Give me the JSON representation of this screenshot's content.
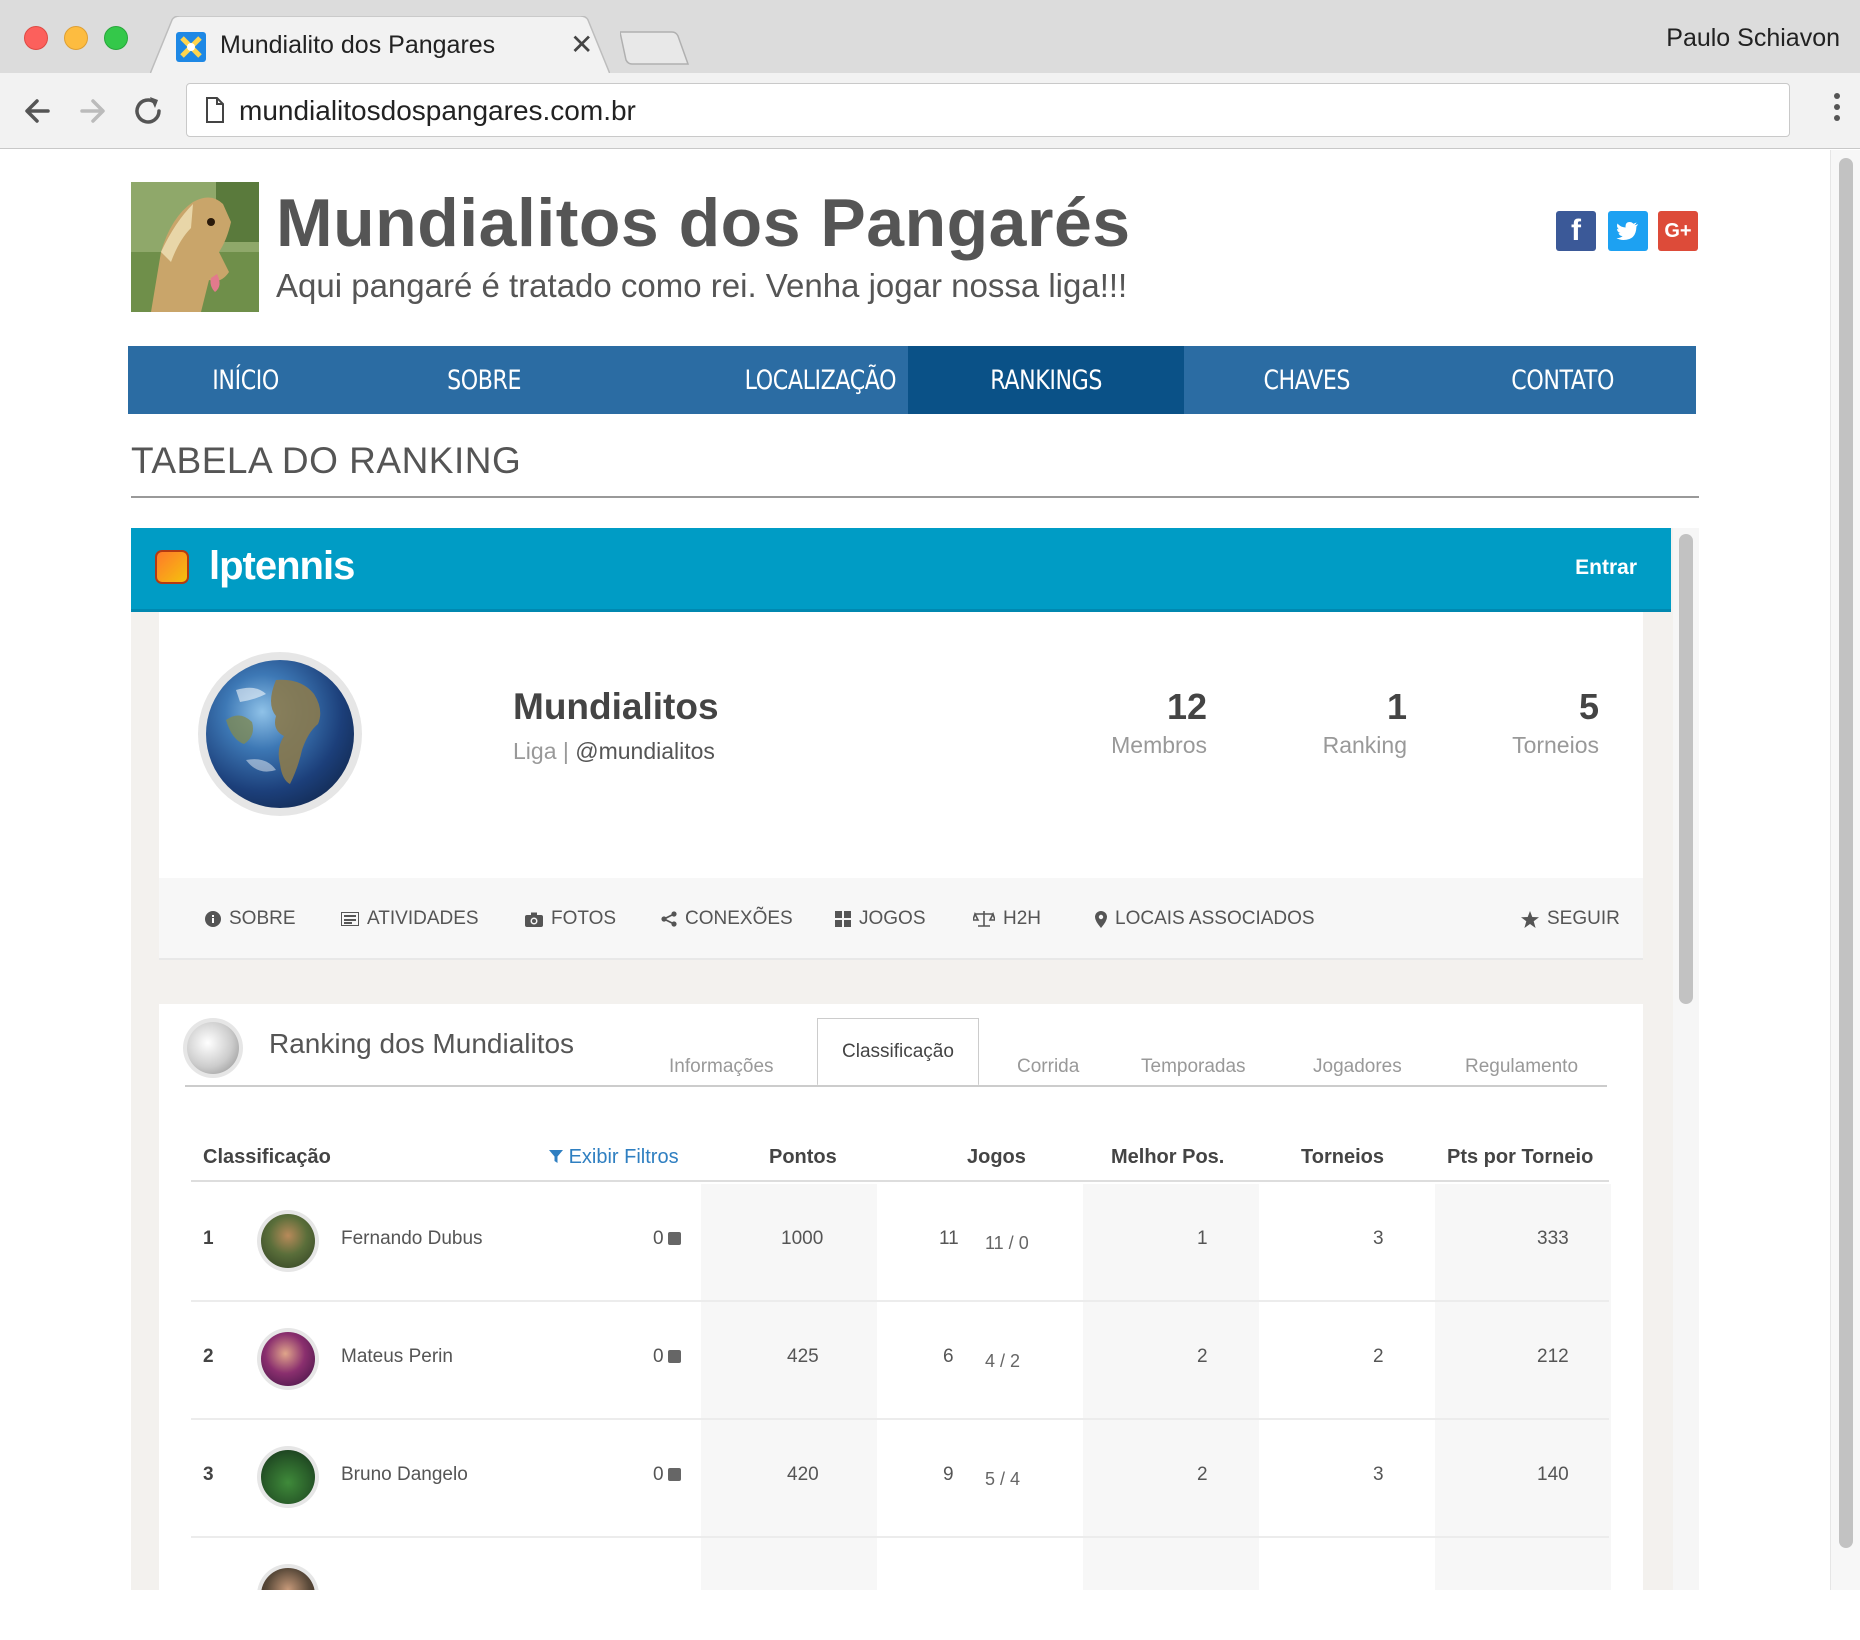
{
  "browser": {
    "tab_title": "Mundialito dos Pangares",
    "profile_name": "Paulo Schiavon",
    "url": "mundialitosdospangares.com.br"
  },
  "site": {
    "title": "Mundialitos dos Pangarés",
    "subtitle": "Aqui pangaré é tratado como rei. Venha jogar nossa liga!!!",
    "social": [
      {
        "label": "f",
        "color": "#3b5998"
      },
      {
        "label": "t",
        "color": "#1da1f2"
      },
      {
        "label": "G+",
        "color": "#dd4b39"
      }
    ]
  },
  "nav": {
    "items": [
      "INÍCIO",
      "SOBRE",
      "LOCALIZAÇÃO",
      "RANKINGS",
      "CHAVES",
      "CONTATO"
    ],
    "active": "RANKINGS"
  },
  "section_title": "TABELA DO RANKING",
  "lptennis": {
    "logo_text": "lptennis",
    "login_label": "Entrar",
    "league": {
      "name": "Mundialitos",
      "type": "Liga",
      "separator": "|",
      "handle": "@mundialitos"
    },
    "stats": [
      {
        "value": "12",
        "label": "Membros"
      },
      {
        "value": "1",
        "label": "Ranking"
      },
      {
        "value": "5",
        "label": "Torneios"
      }
    ],
    "tabs": [
      "SOBRE",
      "ATIVIDADES",
      "FOTOS",
      "CONEXÕES",
      "JOGOS",
      "H2H",
      "LOCAIS ASSOCIADOS"
    ],
    "follow_label": "SEGUIR",
    "ranking": {
      "title": "Ranking dos Mundialitos",
      "subtabs": [
        "Informações",
        "Classificação",
        "Corrida",
        "Temporadas",
        "Jogadores",
        "Regulamento"
      ],
      "active_subtab": "Classificação",
      "columns": {
        "classificacao": "Classificação",
        "filter": "Exibir Filtros",
        "pontos": "Pontos",
        "jogos": "Jogos",
        "melhor_pos": "Melhor Pos.",
        "torneios": "Torneios",
        "pts_por_torneio": "Pts por Torneio"
      },
      "rows": [
        {
          "pos": "1",
          "name": "Fernando Dubus",
          "delta": "0",
          "pontos": "1000",
          "jogos": "11",
          "vd": "11 / 0",
          "melhor": "1",
          "torneios": "3",
          "ppt": "333"
        },
        {
          "pos": "2",
          "name": "Mateus Perin",
          "delta": "0",
          "pontos": "425",
          "jogos": "6",
          "vd": "4 / 2",
          "melhor": "2",
          "torneios": "2",
          "ppt": "212"
        },
        {
          "pos": "3",
          "name": "Bruno Dangelo",
          "delta": "0",
          "pontos": "420",
          "jogos": "9",
          "vd": "5 / 4",
          "melhor": "2",
          "torneios": "3",
          "ppt": "140"
        }
      ]
    }
  }
}
